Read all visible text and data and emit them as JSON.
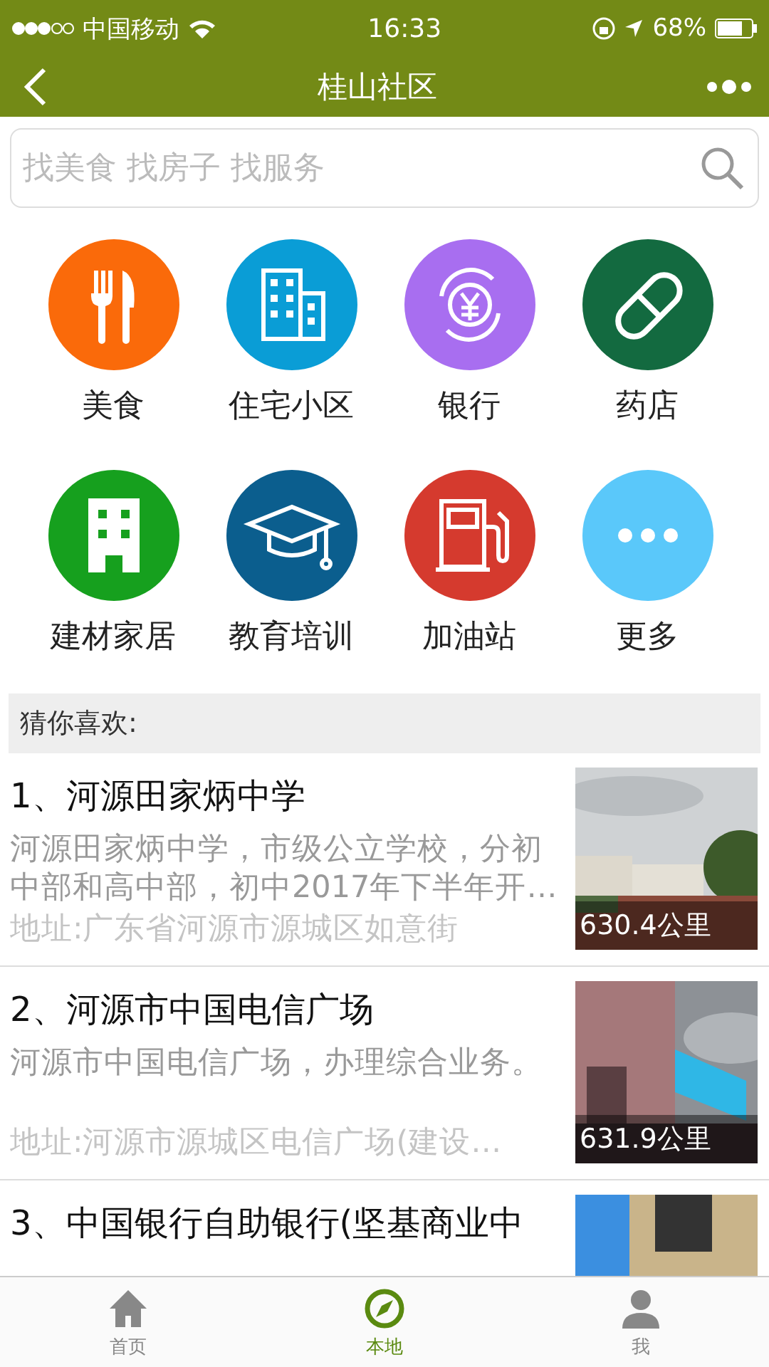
{
  "status_bar": {
    "carrier": "中国移动",
    "time": "16:33",
    "battery": "68%"
  },
  "nav": {
    "title": "桂山社区"
  },
  "search": {
    "placeholder": "找美食 找房子 找服务"
  },
  "categories": [
    {
      "label": "美食",
      "kind": "food",
      "color": "#fa6a0a"
    },
    {
      "label": "住宅小区",
      "kind": "housing",
      "color": "#0a9dd6"
    },
    {
      "label": "银行",
      "kind": "bank",
      "color": "#a86ef0"
    },
    {
      "label": "药店",
      "kind": "pharmacy",
      "color": "#136a40"
    },
    {
      "label": "建材家居",
      "kind": "building",
      "color": "#16a01e"
    },
    {
      "label": "教育培训",
      "kind": "education",
      "color": "#0b5e8e"
    },
    {
      "label": "加油站",
      "kind": "fuel",
      "color": "#d53a2e"
    },
    {
      "label": "更多",
      "kind": "more",
      "color": "#5ac8fa"
    }
  ],
  "section_title": "猜你喜欢:",
  "places": [
    {
      "title": "1、河源田家炳中学",
      "description": "河源田家炳中学，市级公立学校，分初中部和高中部，初中2017年下半年开…",
      "address": "地址:广东省河源市源城区如意街",
      "distance": "630.4公里"
    },
    {
      "title": "2、河源市中国电信广场",
      "description": "河源市中国电信广场，办理综合业务。",
      "address": "地址:河源市源城区电信广场(建设…",
      "distance": "631.9公里"
    },
    {
      "title": "3、中国银行自助银行(坚基商业中"
    }
  ],
  "tabs": [
    {
      "label": "首页",
      "kind": "home",
      "selected": false
    },
    {
      "label": "本地",
      "kind": "local",
      "selected": true
    },
    {
      "label": "我",
      "kind": "me",
      "selected": false
    }
  ]
}
